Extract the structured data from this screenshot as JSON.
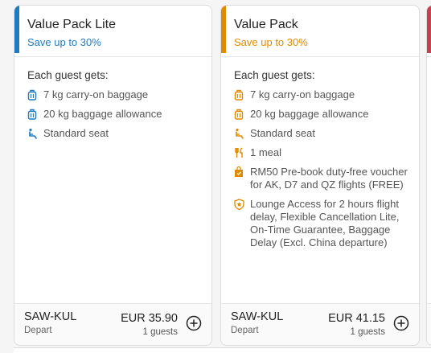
{
  "colors": {
    "lite_accent": "#1f7bbf",
    "lite_sub": "#1f7bbf",
    "pack_accent": "#e08a00",
    "pack_sub": "#e08a00",
    "peek_accent": "#c9404f",
    "icon_lite": "#1f7bbf",
    "icon_pack": "#e08a00"
  },
  "cards": [
    {
      "title": "Value Pack Lite",
      "subtitle": "Save up to 30%",
      "benefits_intro": "Each guest gets:",
      "benefits": [
        {
          "icon": "baggage-icon",
          "text": "7 kg carry-on baggage"
        },
        {
          "icon": "baggage-icon",
          "text": "20 kg baggage allowance"
        },
        {
          "icon": "seat-icon",
          "text": "Standard seat"
        }
      ],
      "route": "SAW-KUL",
      "direction": "Depart",
      "price": "EUR 35.90",
      "guests": "1 guests"
    },
    {
      "title": "Value Pack",
      "subtitle": "Save up to 30%",
      "benefits_intro": "Each guest gets:",
      "benefits": [
        {
          "icon": "baggage-icon",
          "text": "7 kg carry-on baggage"
        },
        {
          "icon": "baggage-icon",
          "text": "20 kg baggage allowance"
        },
        {
          "icon": "seat-icon",
          "text": "Standard seat"
        },
        {
          "icon": "meal-icon",
          "text": "1 meal"
        },
        {
          "icon": "voucher-icon",
          "text": "RM50 Pre-book duty-free voucher for AK, D7 and QZ flights (FREE)"
        },
        {
          "icon": "shield-icon",
          "text": "Lounge Access for 2 hours flight delay, Flexible Cancellation Lite, On-Time Guarantee, Baggage Delay (Excl. China departure)"
        }
      ],
      "route": "SAW-KUL",
      "direction": "Depart",
      "price": "EUR 41.15",
      "guests": "1 guests"
    }
  ]
}
